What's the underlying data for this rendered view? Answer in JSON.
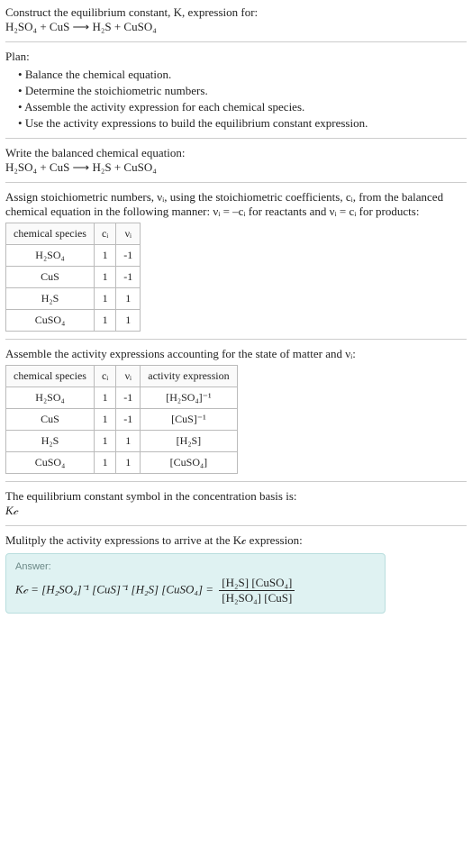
{
  "intro": {
    "line1": "Construct the equilibrium constant, K, expression for:",
    "eq": "H₂SO₄ + CuS ⟶ H₂S + CuSO₄"
  },
  "plan": {
    "heading": "Plan:",
    "items": [
      "Balance the chemical equation.",
      "Determine the stoichiometric numbers.",
      "Assemble the activity expression for each chemical species.",
      "Use the activity expressions to build the equilibrium constant expression."
    ]
  },
  "balanced": {
    "text": "Write the balanced chemical equation:",
    "eq": "H₂SO₄ + CuS ⟶ H₂S + CuSO₄"
  },
  "stoich": {
    "text": "Assign stoichiometric numbers, νᵢ, using the stoichiometric coefficients, cᵢ, from the balanced chemical equation in the following manner: νᵢ = –cᵢ for reactants and νᵢ = cᵢ for products:",
    "headers": [
      "chemical species",
      "cᵢ",
      "νᵢ"
    ],
    "rows": [
      {
        "sp": "H₂SO₄",
        "c": "1",
        "v": "-1"
      },
      {
        "sp": "CuS",
        "c": "1",
        "v": "-1"
      },
      {
        "sp": "H₂S",
        "c": "1",
        "v": "1"
      },
      {
        "sp": "CuSO₄",
        "c": "1",
        "v": "1"
      }
    ]
  },
  "activity": {
    "text": "Assemble the activity expressions accounting for the state of matter and νᵢ:",
    "headers": [
      "chemical species",
      "cᵢ",
      "νᵢ",
      "activity expression"
    ],
    "rows": [
      {
        "sp": "H₂SO₄",
        "c": "1",
        "v": "-1",
        "act": "[H₂SO₄]⁻¹"
      },
      {
        "sp": "CuS",
        "c": "1",
        "v": "-1",
        "act": "[CuS]⁻¹"
      },
      {
        "sp": "H₂S",
        "c": "1",
        "v": "1",
        "act": "[H₂S]"
      },
      {
        "sp": "CuSO₄",
        "c": "1",
        "v": "1",
        "act": "[CuSO₄]"
      }
    ]
  },
  "ksym": {
    "text": "The equilibrium constant symbol in the concentration basis is:",
    "sym": "K𝒸"
  },
  "mult": {
    "text": "Mulitply the activity expressions to arrive at the K𝒸 expression:"
  },
  "answer": {
    "label": "Answer:",
    "lhs": "K𝒸 = [H₂SO₄]⁻¹ [CuS]⁻¹ [H₂S] [CuSO₄] = ",
    "frac_num": "[H₂S] [CuSO₄]",
    "frac_den": "[H₂SO₄] [CuS]"
  },
  "chart_data": {
    "type": "table",
    "tables": [
      {
        "title": "Stoichiometric numbers",
        "headers": [
          "chemical species",
          "c_i",
          "ν_i"
        ],
        "rows": [
          [
            "H2SO4",
            1,
            -1
          ],
          [
            "CuS",
            1,
            -1
          ],
          [
            "H2S",
            1,
            1
          ],
          [
            "CuSO4",
            1,
            1
          ]
        ]
      },
      {
        "title": "Activity expressions",
        "headers": [
          "chemical species",
          "c_i",
          "ν_i",
          "activity expression"
        ],
        "rows": [
          [
            "H2SO4",
            1,
            -1,
            "[H2SO4]^-1"
          ],
          [
            "CuS",
            1,
            -1,
            "[CuS]^-1"
          ],
          [
            "H2S",
            1,
            1,
            "[H2S]"
          ],
          [
            "CuSO4",
            1,
            1,
            "[CuSO4]"
          ]
        ]
      }
    ]
  }
}
